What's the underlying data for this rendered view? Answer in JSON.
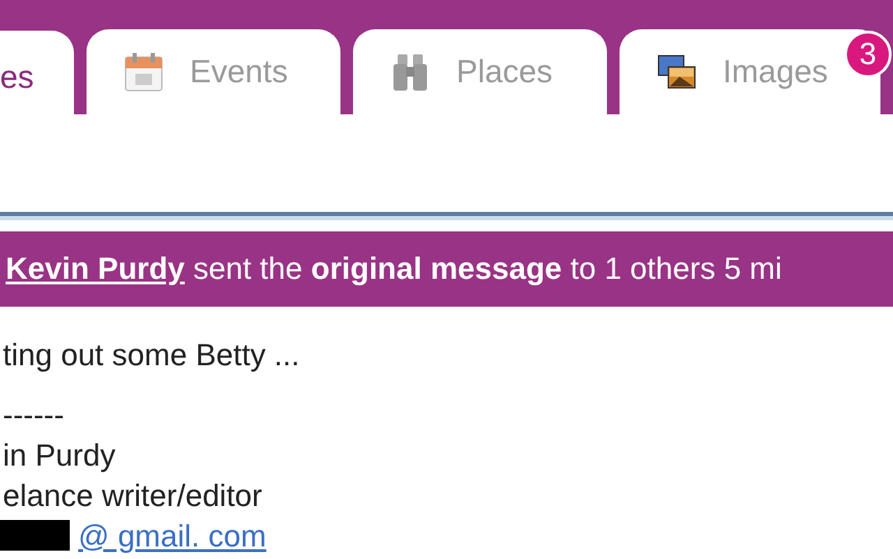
{
  "tabs": [
    {
      "label": "es",
      "kind": "plain",
      "selected": true
    },
    {
      "label": "Events",
      "kind": "calendar",
      "selected": false
    },
    {
      "label": "Places",
      "kind": "binoculars",
      "selected": false
    },
    {
      "label": "Images",
      "kind": "images",
      "selected": false,
      "badge": "3"
    }
  ],
  "banner": {
    "sender": "Kevin Purdy",
    "text": "sent the **original message** to 1 others 5 mi"
  },
  "message": {
    "lines": [
      "ting out some Betty ...",
      "------",
      "in Purdy",
      "elance writer/editor"
    ],
    "email": "@ gmail. com"
  }
}
